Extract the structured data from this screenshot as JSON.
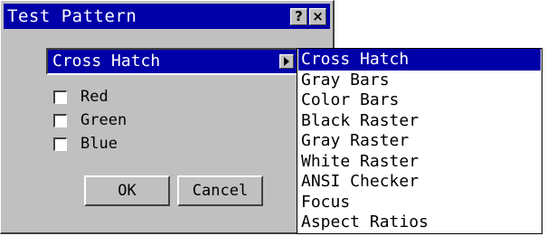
{
  "window": {
    "title": "Test Pattern",
    "help_button": "?",
    "close_button": "×"
  },
  "pattern_select": {
    "selected": "Cross Hatch"
  },
  "checkboxes": [
    {
      "label": "Red",
      "checked": false
    },
    {
      "label": "Green",
      "checked": false
    },
    {
      "label": "Blue",
      "checked": false
    }
  ],
  "buttons": {
    "ok": "OK",
    "cancel": "Cancel"
  },
  "dropdown": {
    "items": [
      "Cross Hatch",
      "Gray Bars",
      "Color Bars",
      "Black Raster",
      "Gray Raster",
      "White Raster",
      "ANSI Checker",
      "Focus",
      "Aspect Ratios"
    ],
    "selected_index": 0
  },
  "colors": {
    "title_bar": "#0000a8",
    "dialog_face": "#c0c0c0",
    "selection": "#0000a8"
  }
}
